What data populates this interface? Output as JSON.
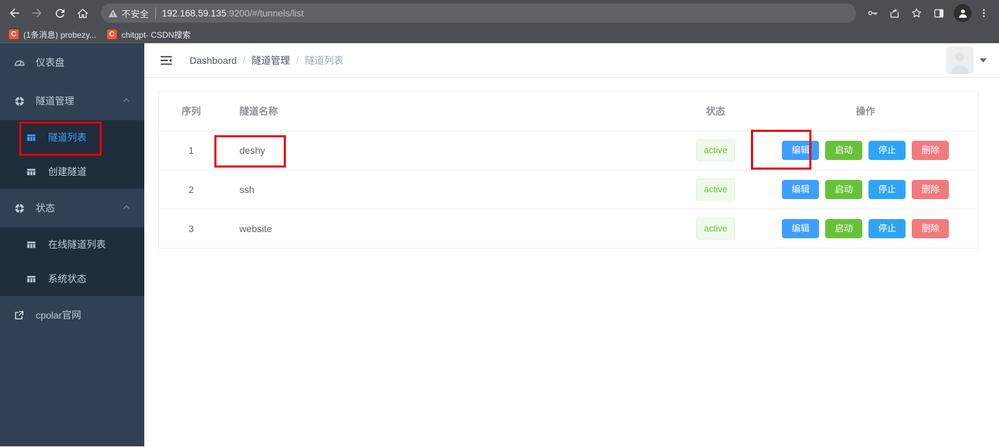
{
  "browser": {
    "nav": {
      "back": "back-arrow",
      "forward": "forward-arrow",
      "reload": "reload",
      "home": "home"
    },
    "omnibox": {
      "security_icon": "warning-triangle-icon",
      "security_label": "不安全",
      "url_host": "192.168.59.135",
      "url_rest": ":9200/#/tunnels/list"
    },
    "actions": [
      "key-icon",
      "share-icon",
      "star-icon",
      "side-panel-icon",
      "profile-icon",
      "kebab-menu-icon"
    ],
    "bookmarks": [
      {
        "favicon_letter": "C",
        "title": "(1条消息) probezy..."
      },
      {
        "favicon_letter": "C",
        "title": "chitgpt- CSDN搜索"
      }
    ]
  },
  "sidebar": {
    "items": [
      {
        "label": "仪表盘",
        "icon": "dashboard-icon",
        "type": "item"
      },
      {
        "label": "隧道管理",
        "icon": "tunnel-icon",
        "type": "group",
        "expanded": true,
        "arrow": "chevron-up-icon"
      },
      {
        "label": "隧道列表",
        "icon": "grid-icon",
        "type": "sub",
        "active": true,
        "highlighted": true
      },
      {
        "label": "创建隧道",
        "icon": "grid-icon",
        "type": "sub",
        "active": false
      },
      {
        "label": "状态",
        "icon": "status-icon",
        "type": "group",
        "expanded": true,
        "arrow": "chevron-up-icon"
      },
      {
        "label": "在线隧道列表",
        "icon": "grid-icon",
        "type": "sub",
        "active": false
      },
      {
        "label": "系统状态",
        "icon": "grid-icon",
        "type": "sub",
        "active": false
      },
      {
        "label": "cpolar官网",
        "icon": "external-link-icon",
        "type": "item"
      }
    ]
  },
  "navbar": {
    "hamburger_icon": "menu-fold-icon",
    "breadcrumb": [
      {
        "label": "Dashboard",
        "current": false
      },
      {
        "label": "隧道管理",
        "current": false
      },
      {
        "label": "隧道列表",
        "current": true
      }
    ],
    "separator": "/",
    "avatar_icon": "user-avatar-icon",
    "dropdown_icon": "caret-down-icon"
  },
  "table": {
    "columns": [
      {
        "key": "seq",
        "label": "序列"
      },
      {
        "key": "name",
        "label": "隧道名称"
      },
      {
        "key": "state",
        "label": "状态"
      },
      {
        "key": "ops",
        "label": "操作"
      }
    ],
    "rows": [
      {
        "seq": "1",
        "name": "deshy",
        "state": "active",
        "name_highlighted": true,
        "edit_highlighted": true
      },
      {
        "seq": "2",
        "name": "ssh",
        "state": "active",
        "name_highlighted": false,
        "edit_highlighted": false
      },
      {
        "seq": "3",
        "name": "website",
        "state": "active",
        "name_highlighted": false,
        "edit_highlighted": false
      }
    ],
    "buttons": [
      {
        "label": "编辑",
        "style": "btn-primary"
      },
      {
        "label": "启动",
        "style": "btn-success"
      },
      {
        "label": "停止",
        "style": "btn-info"
      },
      {
        "label": "删除",
        "style": "btn-danger"
      }
    ]
  },
  "colors": {
    "sidebar_bg": "#304156",
    "submenu_bg": "#1f2d3d",
    "active_blue": "#409eff",
    "success_green": "#67c23a",
    "danger_red": "#f27a7f",
    "highlight_red": "#e60000",
    "tag_bg": "#f0f9eb",
    "chrome_bg": "#4b4e52"
  }
}
